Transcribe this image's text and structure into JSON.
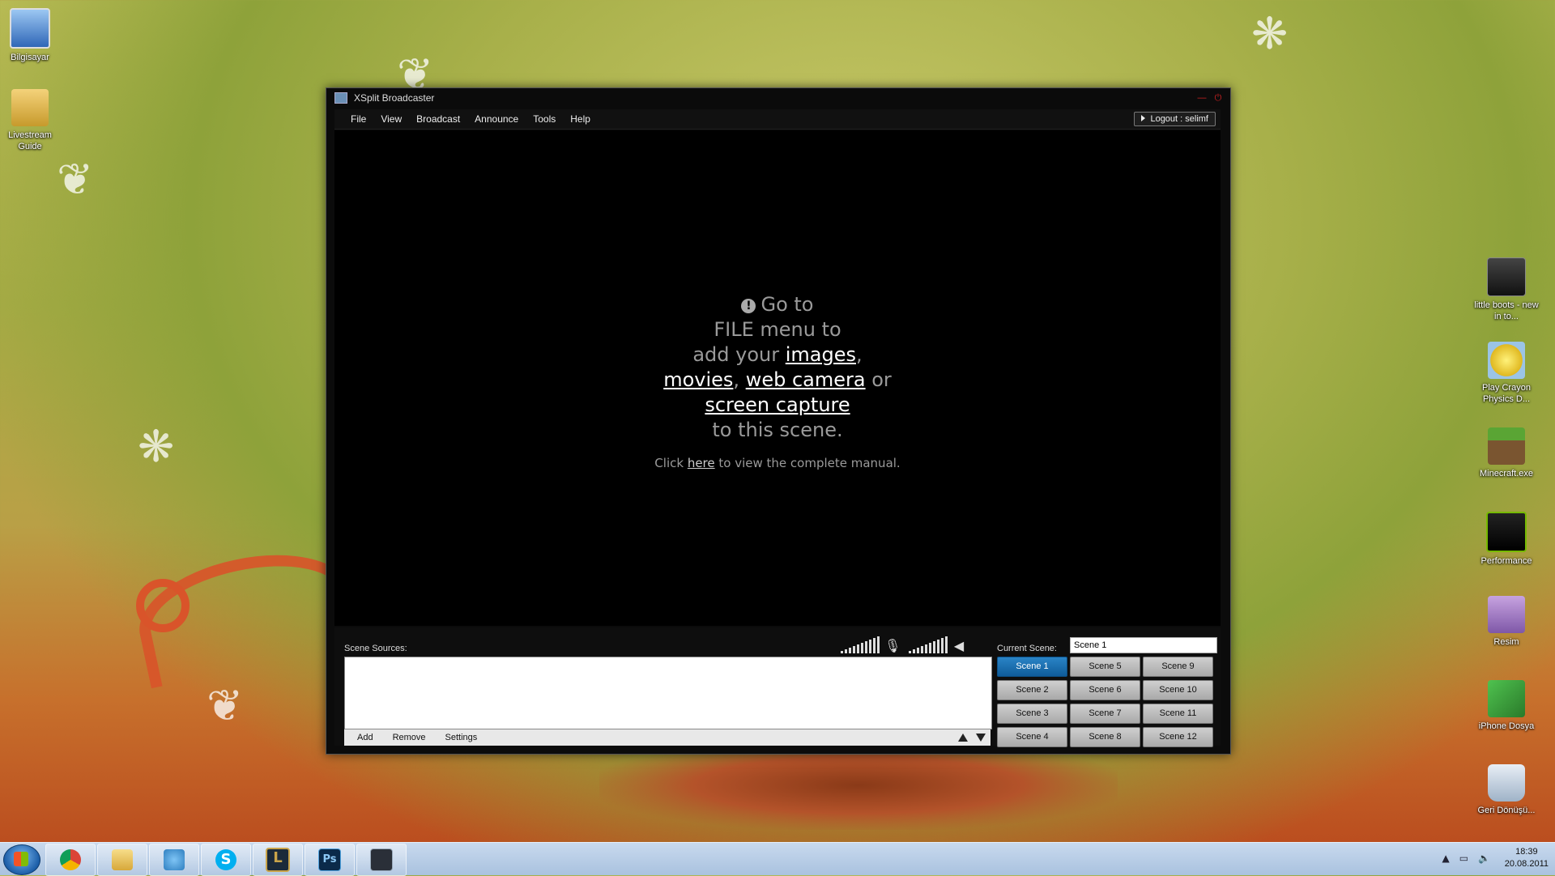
{
  "desktop": {
    "icons_left": [
      {
        "name": "computer-icon",
        "label": "Bilgisayar"
      },
      {
        "name": "folder-icon",
        "label": "Livestream Guide"
      }
    ],
    "icons_right": [
      {
        "name": "album-icon",
        "label": "little boots - new in to..."
      },
      {
        "name": "star-icon",
        "label": "Play Crayon Physics D..."
      },
      {
        "name": "grass-block-icon",
        "label": "Minecraft.exe"
      },
      {
        "name": "nvidia-icon",
        "label": "Performance"
      },
      {
        "name": "floppy-icon",
        "label": "Resim"
      },
      {
        "name": "transfer-icon",
        "label": "iPhone Dosya"
      },
      {
        "name": "recycle-bin-icon",
        "label": "Geri Dönüşü..."
      }
    ]
  },
  "window": {
    "title": "XSplit Broadcaster",
    "menu": [
      "File",
      "View",
      "Broadcast",
      "Announce",
      "Tools",
      "Help"
    ],
    "logout": "Logout : selimf"
  },
  "preview": {
    "line1": "Go to",
    "line2": "FILE menu to",
    "line3a": "add your ",
    "link_images": "images",
    "comma1": ",",
    "link_movies": "movies",
    "comma2": ", ",
    "link_webcam": "web camera",
    "or": " or",
    "link_screen": "screen capture",
    "line5": "to this scene.",
    "manual_a": "Click ",
    "manual_link": "here",
    "manual_b": " to view the complete manual."
  },
  "sources": {
    "label": "Scene Sources:",
    "buttons": [
      "Add",
      "Remove",
      "Settings"
    ]
  },
  "scenes": {
    "current_label": "Current Scene:",
    "current_value": "Scene 1",
    "items": [
      "Scene 1",
      "Scene 5",
      "Scene 9",
      "Scene 2",
      "Scene 6",
      "Scene 10",
      "Scene 3",
      "Scene 7",
      "Scene 11",
      "Scene 4",
      "Scene 8",
      "Scene 12"
    ],
    "active": "Scene 1"
  },
  "taskbar": {
    "time": "18:39",
    "date": "20.08.2011",
    "apps": [
      "chrome-icon",
      "explorer-icon",
      "contacts-icon",
      "skype-icon",
      "league-icon",
      "photoshop-icon",
      "xsplit-icon"
    ],
    "ps_label": "Ps",
    "lol_label": "L"
  },
  "colors": {
    "accent": "#1565a8",
    "window_bg": "#000000"
  }
}
